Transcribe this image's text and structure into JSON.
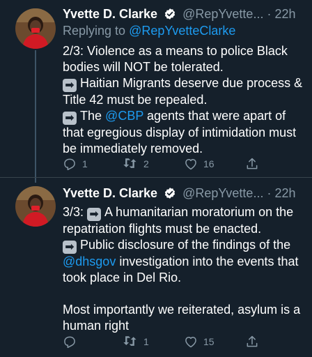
{
  "tweets": [
    {
      "author_name": "Yvette D. Clarke",
      "handle": "@RepYvette...",
      "separator": "·",
      "time": "22h",
      "replying_prefix": "Replying to",
      "replying_handle": "@RepYvetteClarke",
      "lines": {
        "l1": "2/3: Violence as a means to police Black",
        "l2": "bodies will NOT be tolerated.",
        "l3": "Haitian Migrants deserve due process &",
        "l4": "Title 42 must be repealed.",
        "l5_pre": "The",
        "l5_link": "@CBP",
        "l5_post": "agents that were apart of",
        "l6": "that egregious display of intimidation must",
        "l7": "be immediately removed."
      },
      "reply_count": "1",
      "retweet_count": "2",
      "like_count": "16"
    },
    {
      "author_name": "Yvette D. Clarke",
      "handle": "@RepYvette...",
      "separator": "·",
      "time": "22h",
      "lines": {
        "l1_pre": "3/3:",
        "l1_post": "A humanitarian moratorium on the",
        "l2": "repatriation flights must be enacted.",
        "l3": "Public disclosure of the findings of the",
        "l4_link": "@dhsgov",
        "l4_post": "investigation into the events that",
        "l5": "took place in Del Rio.",
        "l6": "Most importantly we reiterated, asylum is a",
        "l7": "human right"
      },
      "reply_count": "",
      "retweet_count": "1",
      "like_count": "15"
    }
  ],
  "icons": {
    "arrow_emoji": "➡",
    "reply": "reply-icon",
    "retweet": "retweet-icon",
    "like": "heart-icon",
    "share": "share-icon",
    "verified": "verified-badge-icon"
  },
  "colors": {
    "background": "#15202b",
    "link": "#1d9bf0",
    "muted": "#8899a6",
    "verified_badge": "#ffffff"
  }
}
